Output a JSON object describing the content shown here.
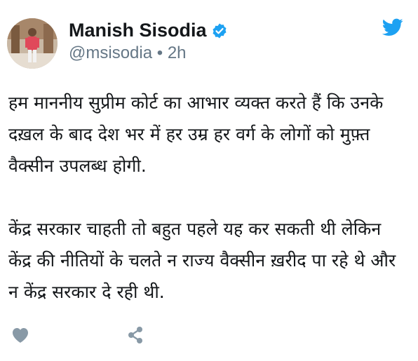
{
  "author": {
    "display_name": "Manish Sisodia",
    "handle": "@msisodia",
    "separator": "•",
    "timestamp": "2h",
    "verified": true
  },
  "tweet": {
    "paragraphs": [
      "हम माननीय सुप्रीम कोर्ट का आभार व्यक्त करते हैं कि उनके दख़ल के बाद देश भर में हर उम्र हर वर्ग के लोगों को मुफ़्त वैक्सीन उपलब्ध होगी.",
      "केंद्र सरकार चाहती तो बहुत पहले यह कर सकती थी लेकिन केंद्र की नीतियों के चलते न राज्य वैक्सीन ख़रीद पा रहे थे और न केंद्र सरकार दे रही थी."
    ]
  },
  "icons": {
    "brand": "twitter-bird-icon",
    "verified": "verified-badge-icon",
    "like": "heart-icon",
    "share": "share-icon"
  },
  "colors": {
    "text": "#14171a",
    "secondary": "#657786",
    "twitter_blue": "#1da1f2",
    "action_icon": "#8899a6"
  }
}
